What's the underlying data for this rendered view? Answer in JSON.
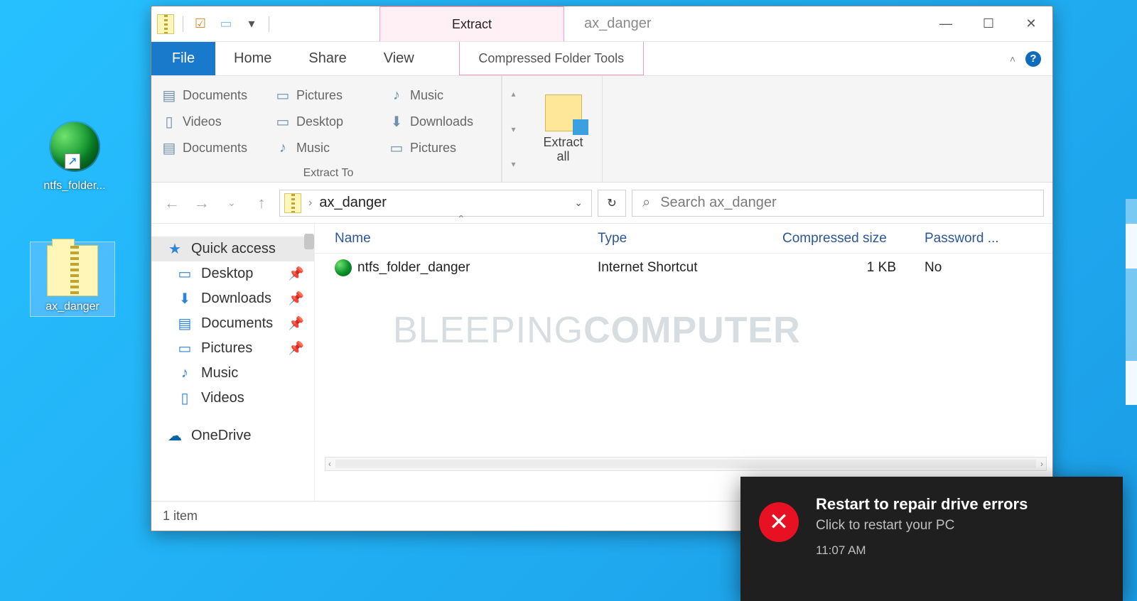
{
  "desktop": {
    "shortcut1_label": "ntfs_folder...",
    "zip_label": "ax_danger"
  },
  "window": {
    "title": "ax_danger",
    "context_header": "Extract",
    "tabs": {
      "file": "File",
      "home": "Home",
      "share": "Share",
      "view": "View",
      "context": "Compressed Folder Tools"
    },
    "ribbon": {
      "items": [
        "Documents",
        "Pictures",
        "Music",
        "Videos",
        "Desktop",
        "Downloads",
        "Documents",
        "Music",
        "Pictures"
      ],
      "group_label": "Extract To",
      "extract_all": "Extract\nall"
    },
    "address": {
      "crumb": "ax_danger"
    },
    "search": {
      "placeholder": "Search ax_danger"
    },
    "nav": {
      "quick": "Quick access",
      "items": [
        "Desktop",
        "Downloads",
        "Documents",
        "Pictures",
        "Music",
        "Videos"
      ],
      "onedrive": "OneDrive"
    },
    "columns": {
      "name": "Name",
      "type": "Type",
      "size": "Compressed size",
      "pw": "Password ..."
    },
    "rows": [
      {
        "name": "ntfs_folder_danger",
        "type": "Internet Shortcut",
        "size": "1 KB",
        "pw": "No"
      }
    ],
    "status": "1 item",
    "watermark1": "BLEEPING",
    "watermark2": "COMPUTER"
  },
  "toast": {
    "title": "Restart to repair drive errors",
    "body": "Click to restart your PC",
    "time": "11:07 AM"
  }
}
